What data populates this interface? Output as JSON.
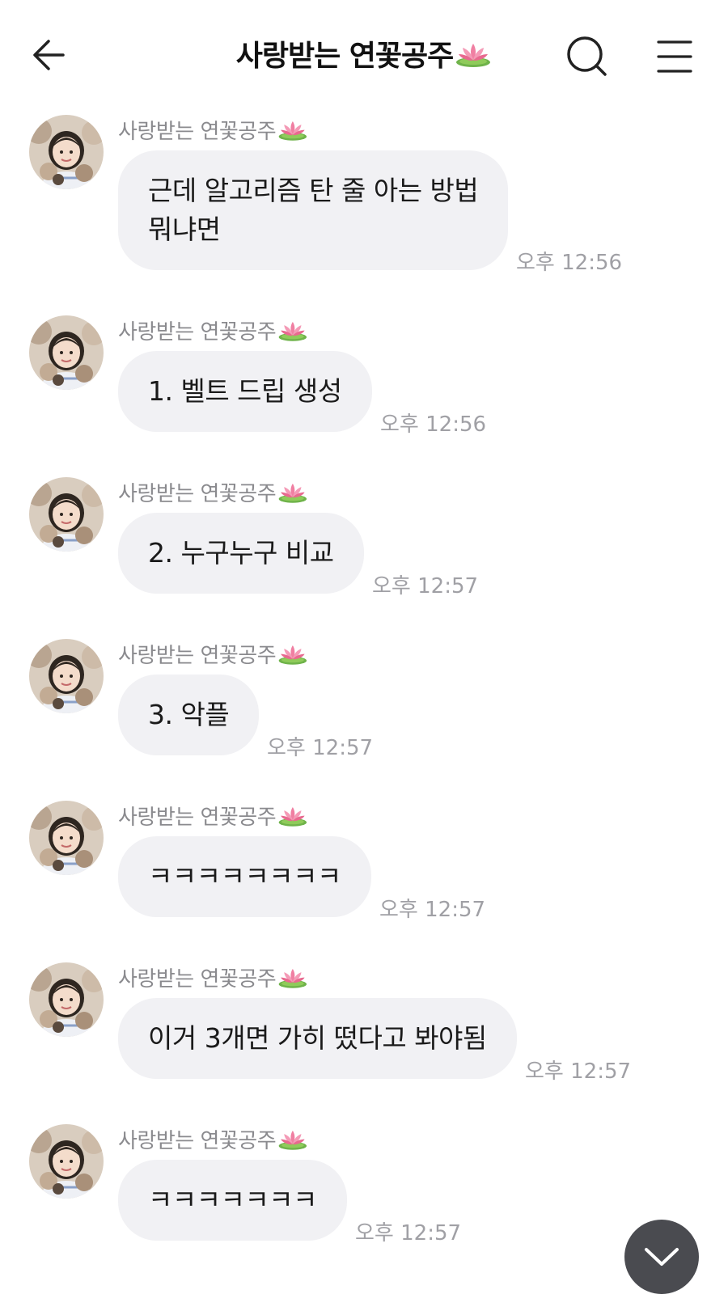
{
  "header": {
    "title": "사랑받는 연꽃공주"
  },
  "icons": {
    "back": "arrow-left-icon",
    "search": "search-icon",
    "menu": "hamburger-menu-icon",
    "title_emoji": "lotus-emoji",
    "scroll_down": "chevron-down-icon"
  },
  "colors": {
    "bubble_bg": "#f1f1f4",
    "timestamp": "#a0a0a5",
    "sender": "#8a8a8e",
    "scroll_button": "#4a4b50"
  },
  "messages": [
    {
      "sender": "사랑받는 연꽃공주",
      "lines": [
        "근데 알고리즘 탄 줄 아는 방법",
        "뭐냐면"
      ],
      "time": "오후 12:56"
    },
    {
      "sender": "사랑받는 연꽃공주",
      "lines": [
        "1. 벨트 드립 생성"
      ],
      "time": "오후 12:56"
    },
    {
      "sender": "사랑받는 연꽃공주",
      "lines": [
        "2. 누구누구 비교"
      ],
      "time": "오후 12:57"
    },
    {
      "sender": "사랑받는 연꽃공주",
      "lines": [
        "3. 악플"
      ],
      "time": "오후 12:57"
    },
    {
      "sender": "사랑받는 연꽃공주",
      "lines": [
        "ㅋㅋㅋㅋㅋㅋㅋㅋ"
      ],
      "time": "오후 12:57"
    },
    {
      "sender": "사랑받는 연꽃공주",
      "lines": [
        "이거 3개면 가히 떴다고 봐야됨"
      ],
      "time": "오후 12:57"
    },
    {
      "sender": "사랑받는 연꽃공주",
      "lines": [
        "ㅋㅋㅋㅋㅋㅋㅋ"
      ],
      "time": "오후 12:57"
    }
  ]
}
